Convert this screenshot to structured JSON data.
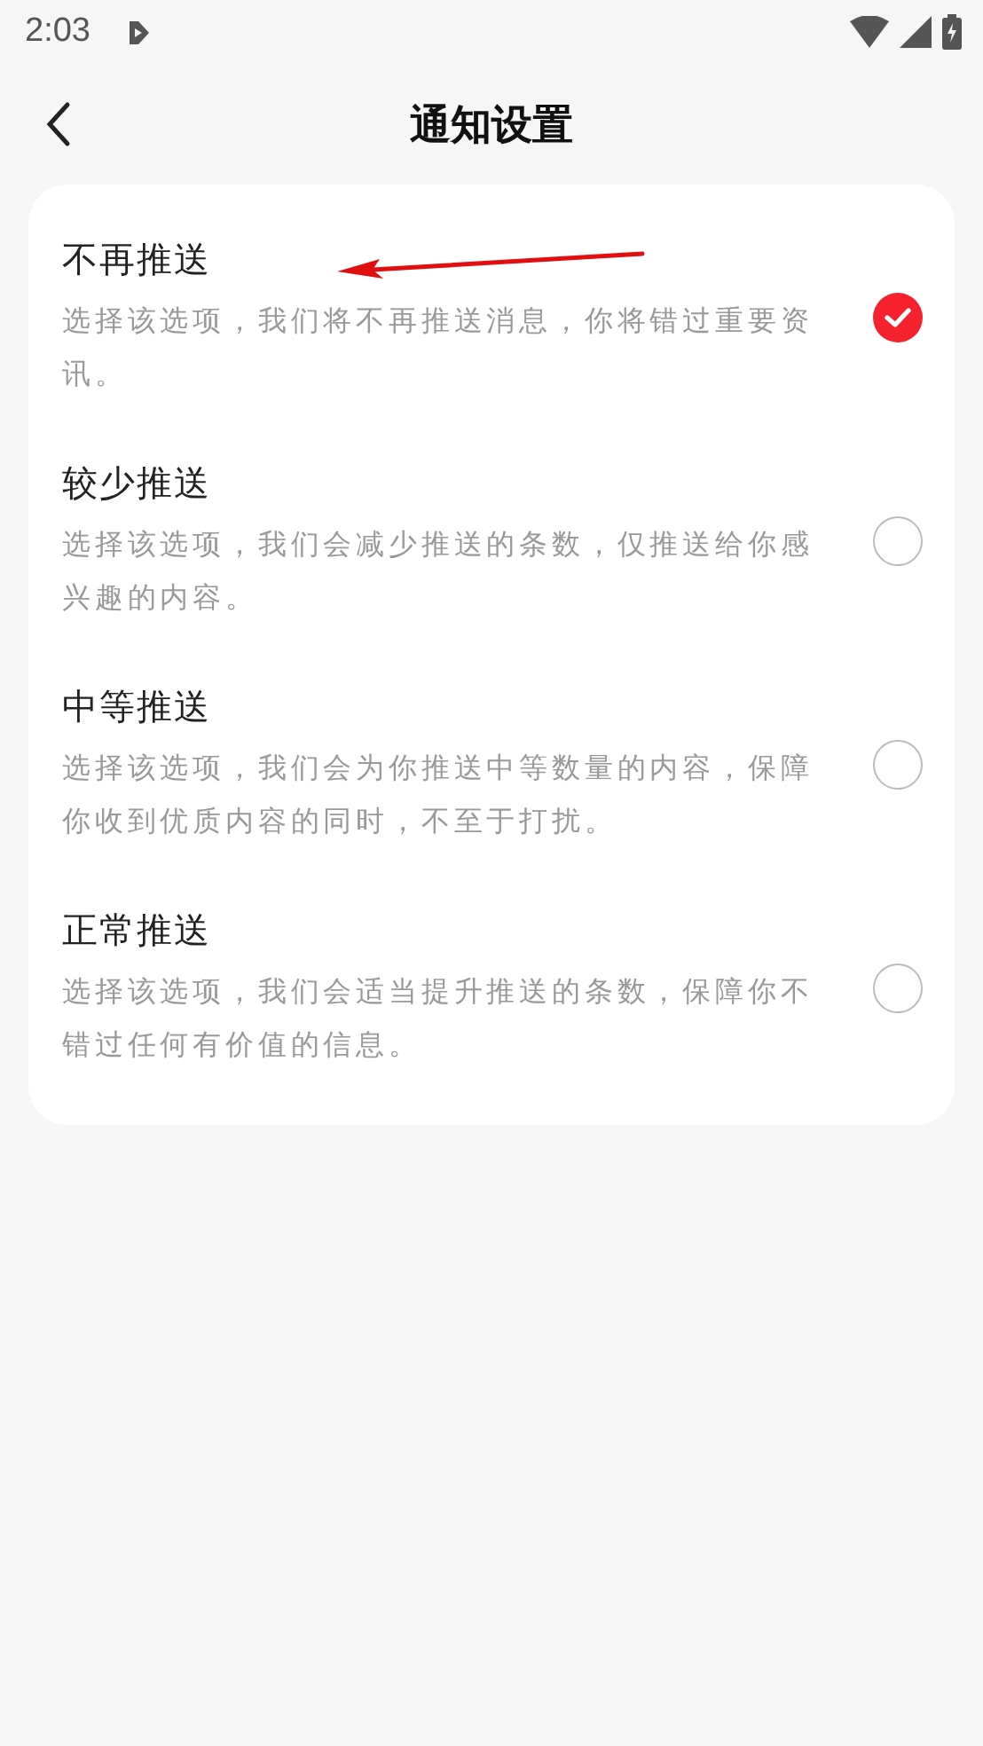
{
  "status_bar": {
    "time": "2:03"
  },
  "header": {
    "title": "通知设置"
  },
  "options": [
    {
      "title": "不再推送",
      "description": "选择该选项，我们将不再推送消息，你将错过重要资讯。",
      "selected": true
    },
    {
      "title": "较少推送",
      "description": "选择该选项，我们会减少推送的条数，仅推送给你感兴趣的内容。",
      "selected": false
    },
    {
      "title": "中等推送",
      "description": "选择该选项，我们会为你推送中等数量的内容，保障你收到优质内容的同时，不至于打扰。",
      "selected": false
    },
    {
      "title": "正常推送",
      "description": "选择该选项，我们会适当提升推送的条数，保障你不错过任何有价值的信息。",
      "selected": false
    }
  ]
}
